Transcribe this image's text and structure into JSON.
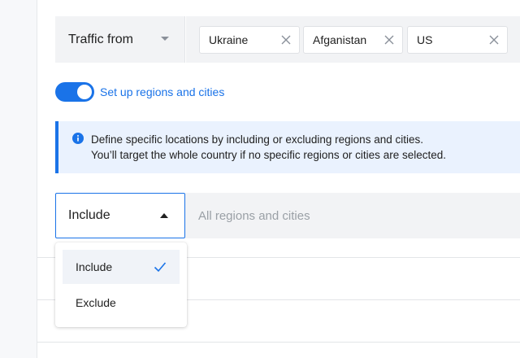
{
  "traffic": {
    "label": "Traffic from",
    "chips": [
      {
        "label": "Ukraine"
      },
      {
        "label": "Afganistan"
      },
      {
        "label": "US"
      }
    ]
  },
  "regions_toggle": {
    "label": "Set up regions and cities",
    "on": true
  },
  "info": {
    "line1": "Define specific locations by including or excluding regions and cities.",
    "line2": "You’ll target the whole country if no specific regions or cities are selected."
  },
  "include_select": {
    "value": "Include",
    "options": [
      "Include",
      "Exclude"
    ],
    "selected_index": 0
  },
  "regions_field": {
    "placeholder": "All regions and cities"
  },
  "colors": {
    "accent": "#1a73e8",
    "banner_bg": "#eaf2fe",
    "field_bg": "#f2f3f5"
  }
}
